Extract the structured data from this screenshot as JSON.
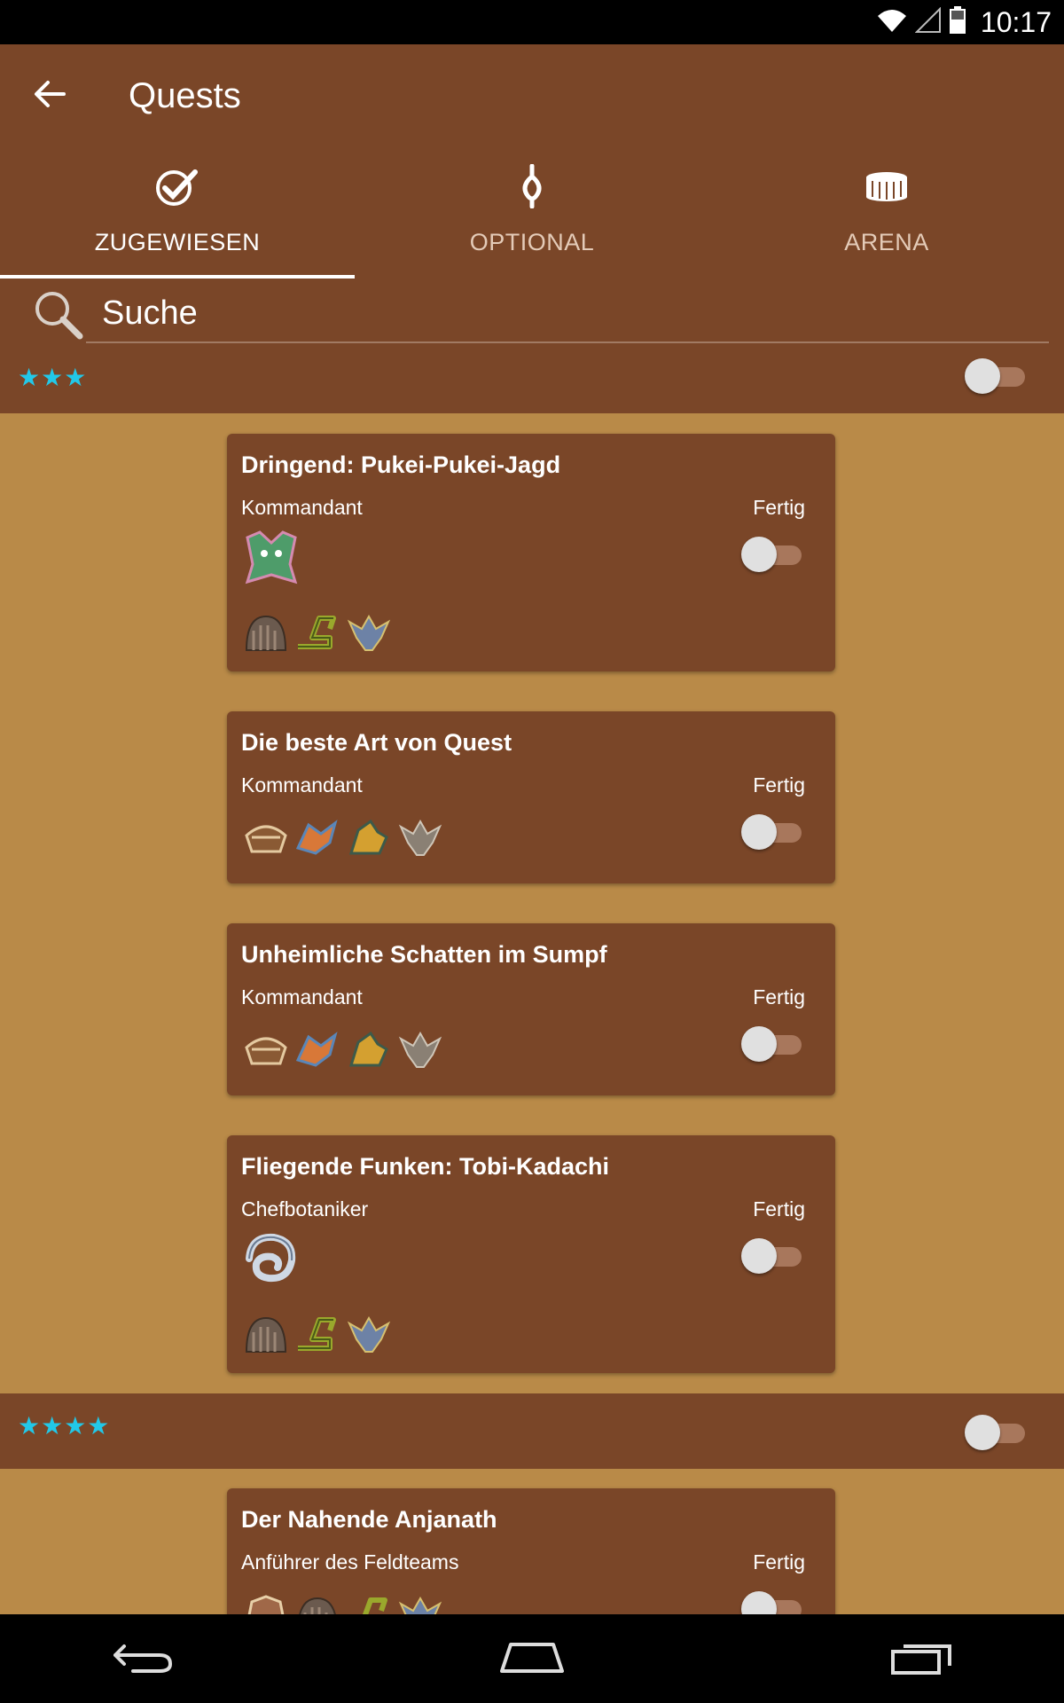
{
  "status_bar": {
    "time": "10:17",
    "icons": [
      "wifi-icon",
      "cell-signal-icon",
      "battery-icon"
    ]
  },
  "app_bar": {
    "title": "Quests",
    "back_icon": "arrow-back-icon"
  },
  "tabs": [
    {
      "label": "ZUGEWIESEN",
      "icon": "check-badge-icon",
      "active": true
    },
    {
      "label": "OPTIONAL",
      "icon": "fork-path-icon",
      "active": false
    },
    {
      "label": "ARENA",
      "icon": "arena-icon",
      "active": false
    }
  ],
  "search": {
    "placeholder": "Suche",
    "value": ""
  },
  "groups": [
    {
      "stars": "★★★",
      "toggle_on": false,
      "quests": [
        {
          "title": "Dringend: Pukei-Pukei-Jagd",
          "giver": "Kommandant",
          "done_label": "Fertig",
          "done": false,
          "target_monsters": [
            "pukei-pukei-icon"
          ],
          "monsters": [
            "kestodon-icon",
            "great-jagras-icon",
            "kulu-ya-ku-icon"
          ]
        },
        {
          "title": "Die beste Art von Quest",
          "giver": "Kommandant",
          "done_label": "Fertig",
          "done": false,
          "target_monsters": [],
          "monsters": [
            "barroth-icon",
            "tobi-kadachi-icon",
            "great-girros-icon",
            "kulu-ya-ku-icon"
          ]
        },
        {
          "title": "Unheimliche Schatten im Sumpf",
          "giver": "Kommandant",
          "done_label": "Fertig",
          "done": false,
          "target_monsters": [],
          "monsters": [
            "barroth-icon",
            "tobi-kadachi-icon",
            "great-girros-icon",
            "kulu-ya-ku-icon"
          ]
        },
        {
          "title": "Fliegende Funken: Tobi-Kadachi",
          "giver": "Chefbotaniker",
          "done_label": "Fertig",
          "done": false,
          "target_monsters": [
            "legiana-icon"
          ],
          "monsters": [
            "kestodon-icon",
            "great-jagras-icon",
            "kulu-ya-ku-icon"
          ]
        }
      ]
    },
    {
      "stars": "★★★★",
      "toggle_on": false,
      "quests": [
        {
          "title": "Der Nahende Anjanath",
          "giver": "Anführer des Feldteams",
          "done_label": "Fertig",
          "done": false,
          "target_monsters": [],
          "monsters": [
            "anjanath-icon",
            "kestodon-icon",
            "great-jagras-icon",
            "kulu-ya-ku-icon"
          ]
        }
      ]
    }
  ],
  "nav_bar": {
    "buttons": [
      "back-nav-icon",
      "home-nav-icon",
      "recents-nav-icon"
    ]
  },
  "colors": {
    "primary": "#7a4628",
    "background": "#b98a48",
    "star": "#22c8e8"
  }
}
